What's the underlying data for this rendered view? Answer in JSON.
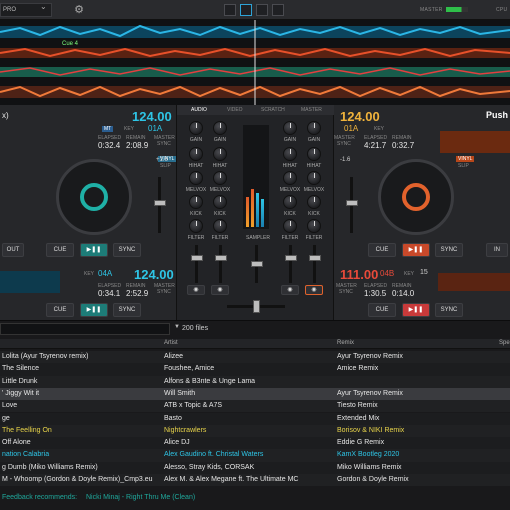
{
  "topbar": {
    "preset": "PRO",
    "master_label": "MASTER",
    "cpu_label": "CPU"
  },
  "waveform": {
    "cue_label": "Cue 4"
  },
  "left_deck": {
    "track_title_tail": "x)",
    "bpm": "124.00",
    "mt": "MT",
    "key_label": "KEY",
    "key_value": "01A",
    "elapsed_label": "ELAPSED",
    "elapsed": "0:32.4",
    "remain_label": "REMAIN",
    "remain": "2:08.9",
    "master_label": "MASTER",
    "sync_label": "SYNC",
    "vinyl_label": "VINYL",
    "slip_label": "SLIP",
    "pitch": "+1.6",
    "out_label": "OUT",
    "cue_label": "CUE",
    "sync_button": "SYNC"
  },
  "right_deck": {
    "bpm": "124.00",
    "title": "Push",
    "key_label": "KEY",
    "key_value": "01A",
    "elapsed_label": "ELAPSED",
    "elapsed": "4:21.7",
    "remain_label": "REMAIN",
    "remain": "0:32.7",
    "master_label": "MASTER",
    "sync_label": "SYNC",
    "vinyl_label": "VINYL",
    "slip_label": "SLIP",
    "pitch": "-1.6",
    "in_label": "IN",
    "cue_label": "CUE",
    "sync_button": "SYNC"
  },
  "left_deck2": {
    "key_label": "KEY",
    "key_value": "04A",
    "bpm": "124.00",
    "elapsed_label": "ELAPSED",
    "elapsed": "0:34.1",
    "remain_label": "REMAIN",
    "remain": "2:52.9",
    "master_label": "MASTER",
    "sync_label": "SYNC",
    "cue_label": "CUE",
    "sync_button": "SYNC"
  },
  "right_deck2": {
    "bpm": "111.00",
    "key_value": "04B",
    "key_label": "KEY",
    "num": "15",
    "elapsed_label": "ELAPSED",
    "elapsed": "1:30.5",
    "remain_label": "REMAIN",
    "remain": "0:14.0",
    "master_label": "MASTER",
    "sync_label": "SYNC",
    "cue_label": "CUE",
    "sync_button": "SYNC"
  },
  "mixer": {
    "tabs": [
      "AUDIO",
      "VIDEO",
      "SCRATCH",
      "MASTER"
    ],
    "gain": "GAIN",
    "hihat": "HIHAT",
    "melvox": "MELVOX",
    "kick": "KICK",
    "filter": "FILTER",
    "sampler": "SAMPLER"
  },
  "browser": {
    "file_count": "200 files",
    "headers": {
      "artist": "Artist",
      "remix": "Remix",
      "tail": "Spe"
    },
    "rows": [
      {
        "title": "Lolita (Ayur Tsyrenov remix)",
        "artist": "Alizee",
        "remix": "Ayur Tsyrenov Remix",
        "color": "#e6e6e6"
      },
      {
        "title": "The Silence",
        "artist": "Foushee, Amice",
        "remix": "Amice Remix",
        "color": "#e6e6e6"
      },
      {
        "title": "Little Drunk",
        "artist": "Alfons & B3nte & Unge Lama",
        "remix": "",
        "color": "#e6e6e6"
      },
      {
        "title": "' Jiggy Wit it",
        "artist": "Will Smith",
        "remix": "Ayur Tsyrenov Remix",
        "color": "#e6e6e6"
      },
      {
        "title": "Love",
        "artist": "ATB x Topic & A7S",
        "remix": "Tiesto Remix",
        "color": "#e6e6e6"
      },
      {
        "title": "ge",
        "artist": "Basto",
        "remix": "Extended Mix",
        "color": "#e6e6e6"
      },
      {
        "title": "The Feelling On",
        "artist": "Nightcrawlers",
        "remix": "Borisov & NIKI Remix",
        "color": "#e8d44a"
      },
      {
        "title": "Off Alone",
        "artist": "Alice DJ",
        "remix": "Eddie G Remix",
        "color": "#e6e6e6"
      },
      {
        "title": "nation Calabria",
        "artist": "Alex Gaudino ft. Christal Waters",
        "remix": "KamX Bootleg 2020",
        "color": "#2ec5e6"
      },
      {
        "title": "g Dumb (Miko Williams Remix)",
        "artist": "Alesso, Stray Kids, CORSAK",
        "remix": "Miko Williams Remix",
        "color": "#e6e6e6"
      },
      {
        "title": "M - Whoomp (Gordon & Doyle Remix)_Cmp3.eu",
        "artist": "Alex M. & Alex Megane ft. The Ultimate MC",
        "remix": "Gordon & Doyle Remix",
        "color": "#e6e6e6"
      }
    ],
    "feedback": "Feedback recommends:",
    "feedback_track": "Nicki Minaj - Right Thru Me (Clean)"
  }
}
